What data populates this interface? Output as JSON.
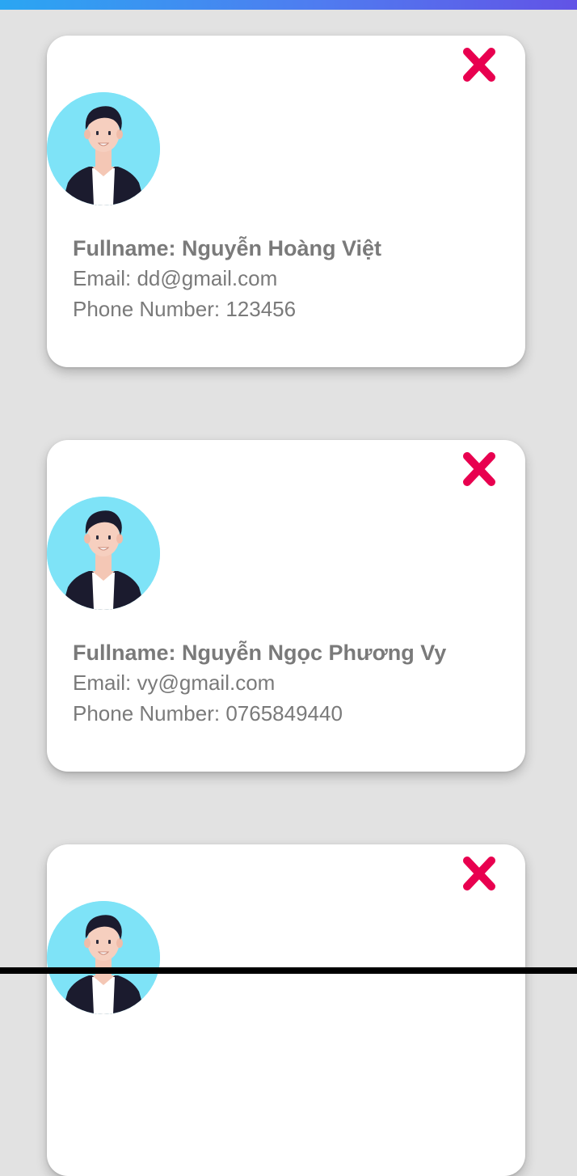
{
  "contacts": [
    {
      "fullname_label": "Fullname: Nguyễn Hoàng Việt",
      "email_label": "Email: dd@gmail.com",
      "phone_label": "Phone Number: 123456"
    },
    {
      "fullname_label": "Fullname: Nguyễn Ngọc Phương Vy",
      "email_label": "Email: vy@gmail.com",
      "phone_label": "Phone Number: 0765849440"
    },
    {
      "fullname_label": "",
      "email_label": "",
      "phone_label": ""
    }
  ],
  "icons": {
    "delete": "close-icon",
    "avatar": "user-avatar"
  },
  "colors": {
    "background": "#e2e2e2",
    "card": "#ffffff",
    "delete_icon": "#e8004f",
    "avatar_bg": "#7ee3f7",
    "text": "#7a7a7a"
  }
}
